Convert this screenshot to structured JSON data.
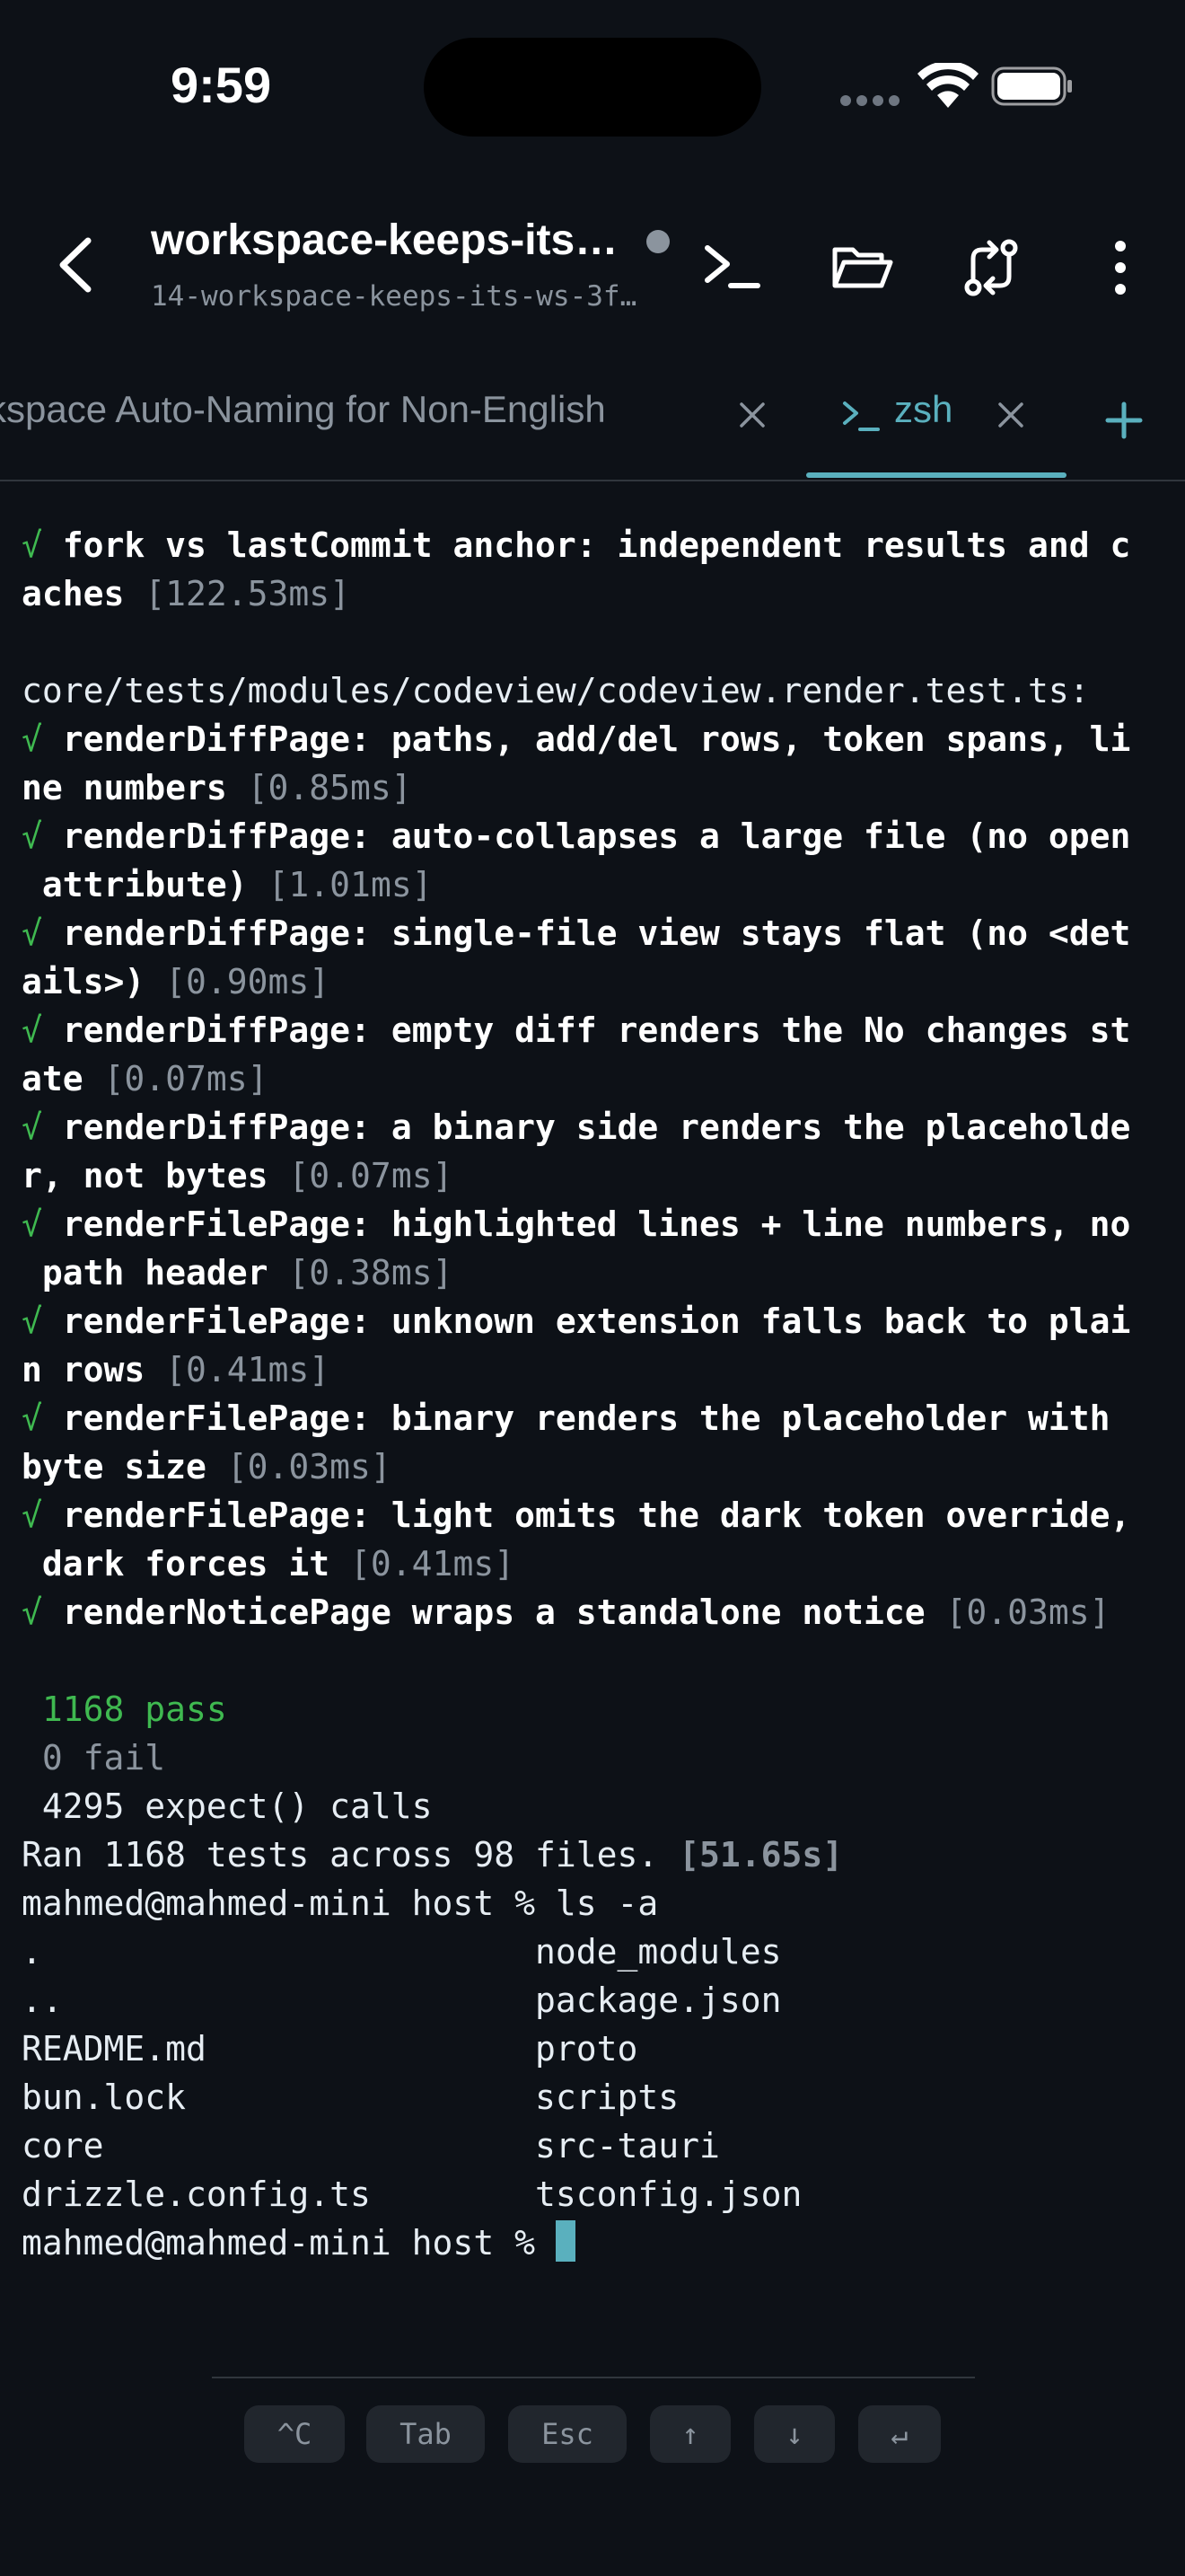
{
  "status_bar": {
    "time": "9:59"
  },
  "header": {
    "title": "workspace-keeps-its…",
    "subtitle": "14-workspace-keeps-its-ws-3f…"
  },
  "tabs": [
    {
      "label": "kspace Auto-Naming for Non-English",
      "active": false
    },
    {
      "label": "zsh",
      "active": true
    }
  ],
  "terminal": {
    "lines": [
      {
        "check": "√",
        "bold": " fork vs lastCommit anchor: independent results and c",
        "dim": ""
      },
      {
        "check": "",
        "bold": "aches",
        "dim": " [122.53ms]"
      },
      {
        "text": ""
      },
      {
        "text": "core/tests/modules/codeview/codeview.render.test.ts:"
      },
      {
        "check": "√",
        "bold": " renderDiffPage: paths, add/del rows, token spans, li",
        "dim": ""
      },
      {
        "check": "",
        "bold": "ne numbers",
        "dim": " [0.85ms]"
      },
      {
        "check": "√",
        "bold": " renderDiffPage: auto-collapses a large file (no open",
        "dim": ""
      },
      {
        "check": "",
        "bold": " attribute)",
        "dim": " [1.01ms]"
      },
      {
        "check": "√",
        "bold": " renderDiffPage: single-file view stays flat (no <det",
        "dim": ""
      },
      {
        "check": "",
        "bold": "ails>)",
        "dim": " [0.90ms]"
      },
      {
        "check": "√",
        "bold": " renderDiffPage: empty diff renders the No changes st",
        "dim": ""
      },
      {
        "check": "",
        "bold": "ate",
        "dim": " [0.07ms]"
      },
      {
        "check": "√",
        "bold": " renderDiffPage: a binary side renders the placeholde",
        "dim": ""
      },
      {
        "check": "",
        "bold": "r, not bytes",
        "dim": " [0.07ms]"
      },
      {
        "check": "√",
        "bold": " renderFilePage: highlighted lines + line numbers, no",
        "dim": ""
      },
      {
        "check": "",
        "bold": " path header",
        "dim": " [0.38ms]"
      },
      {
        "check": "√",
        "bold": " renderFilePage: unknown extension falls back to plai",
        "dim": ""
      },
      {
        "check": "",
        "bold": "n rows",
        "dim": " [0.41ms]"
      },
      {
        "check": "√",
        "bold": " renderFilePage: binary renders the placeholder with",
        "dim": ""
      },
      {
        "check": "",
        "bold": "byte size",
        "dim": " [0.03ms]"
      },
      {
        "check": "√",
        "bold": " renderFilePage: light omits the dark token override,",
        "dim": ""
      },
      {
        "check": "",
        "bold": " dark forces it",
        "dim": " [0.41ms]"
      },
      {
        "check": "√",
        "bold": " renderNoticePage wraps a standalone notice",
        "dim": " [0.03ms]"
      },
      {
        "text": ""
      },
      {
        "pass": " 1168 pass"
      },
      {
        "dimtext": " 0 fail"
      },
      {
        "text": " 4295 expect() calls"
      },
      {
        "text": "Ran 1168 tests across 98 files.",
        "bolddim": " [51.65s]"
      },
      {
        "text": "mahmed@mahmed-mini host % ls -a"
      },
      {
        "text": ".                        node_modules"
      },
      {
        "text": "..                       package.json"
      },
      {
        "text": "README.md                proto"
      },
      {
        "text": "bun.lock                 scripts"
      },
      {
        "text": "core                     src-tauri"
      },
      {
        "text": "drizzle.config.ts        tsconfig.json"
      },
      {
        "text": "mahmed@mahmed-mini host % ",
        "cursor": true
      }
    ]
  },
  "accessory_keys": [
    "^C",
    "Tab",
    "Esc",
    "↑",
    "↓",
    "↵"
  ]
}
